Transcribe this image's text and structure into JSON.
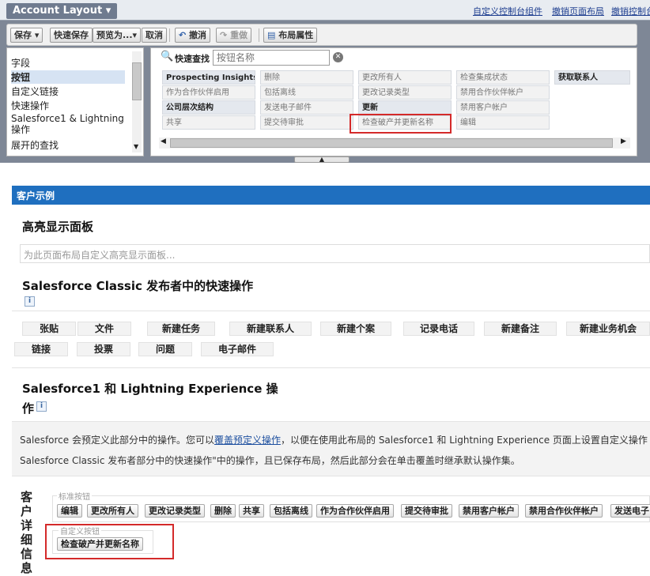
{
  "header": {
    "layout_title": "Account Layout",
    "links": [
      "自定义控制台组件",
      "撤销页面布局",
      "撤销控制台..."
    ]
  },
  "toolbar": {
    "save": "保存",
    "quick_save": "快速保存",
    "preview": "预览为...",
    "cancel": "取消",
    "undo": "撤消",
    "redo": "重做",
    "layout_props": "布局属性"
  },
  "categories": [
    "字段",
    "按钮",
    "自定义链接",
    "快速操作",
    "Salesforce1 & Lightning 操作",
    "展开的查找"
  ],
  "selected_category": "按钮",
  "quick_find": {
    "label": "快速查找",
    "placeholder": "按钮名称"
  },
  "button_palette": [
    [
      "Prospecting Insights",
      "删除",
      "更改所有人",
      "检查集成状态",
      "获取联系人"
    ],
    [
      "作为合作伙伴启用",
      "包括离线",
      "更改记录类型",
      "禁用合作伙伴帐户",
      ""
    ],
    [
      "公司层次结构",
      "发送电子邮件",
      "更新",
      "禁用客户帐户",
      ""
    ],
    [
      "共享",
      "提交待审批",
      "检查破产并更新名称",
      "编辑",
      ""
    ]
  ],
  "main": {
    "section_title": "客户示例",
    "highlights": {
      "title": "高亮显示面板",
      "placeholder": "为此页面布局自定义高亮显示面板..."
    },
    "classic_actions": {
      "title": "Salesforce Classic 发布者中的快速操作",
      "info": "i",
      "row1": [
        "张贴",
        "文件",
        "新建任务",
        "新建联系人",
        "新建个案",
        "记录电话",
        "新建备注",
        "新建业务机会"
      ],
      "row2": [
        "链接",
        "投票",
        "问题",
        "电子邮件"
      ]
    },
    "sf1_actions": {
      "title_line1": "Salesforce1 和 Lightning Experience 操",
      "title_line2": "作",
      "info": "i",
      "line1_a": "Salesforce 会预定义此部分中的操作。您可以",
      "line1_link": "覆盖预定义操作",
      "line1_b": "，以便在使用此布局的 Salesforce1 和 Lightning Experience 页面上设置自定义操作",
      "line2": "Salesforce Classic 发布者部分中的快速操作\"中的操作，且已保存布局，然后此部分会在单击覆盖时继承默认操作集。"
    },
    "detail": {
      "label_chars": [
        "客",
        "户",
        "详",
        "细",
        "信",
        "息"
      ],
      "standard_legend": "标准按钮",
      "standard_buttons": [
        "编辑",
        "更改所有人",
        "更改记录类型",
        "删除",
        "共享",
        "包括离线",
        "作为合作伙伴启用",
        "提交待审批",
        "禁用客户帐户",
        "禁用合作伙伴帐户",
        "发送电子"
      ],
      "custom_legend": "自定义按钮",
      "custom_buttons": [
        "检查破产并更新名称"
      ]
    }
  },
  "colors": {
    "accent": "#1f6fbf",
    "highlight": "#d42a2a",
    "palette_bg": "#7e8796"
  }
}
